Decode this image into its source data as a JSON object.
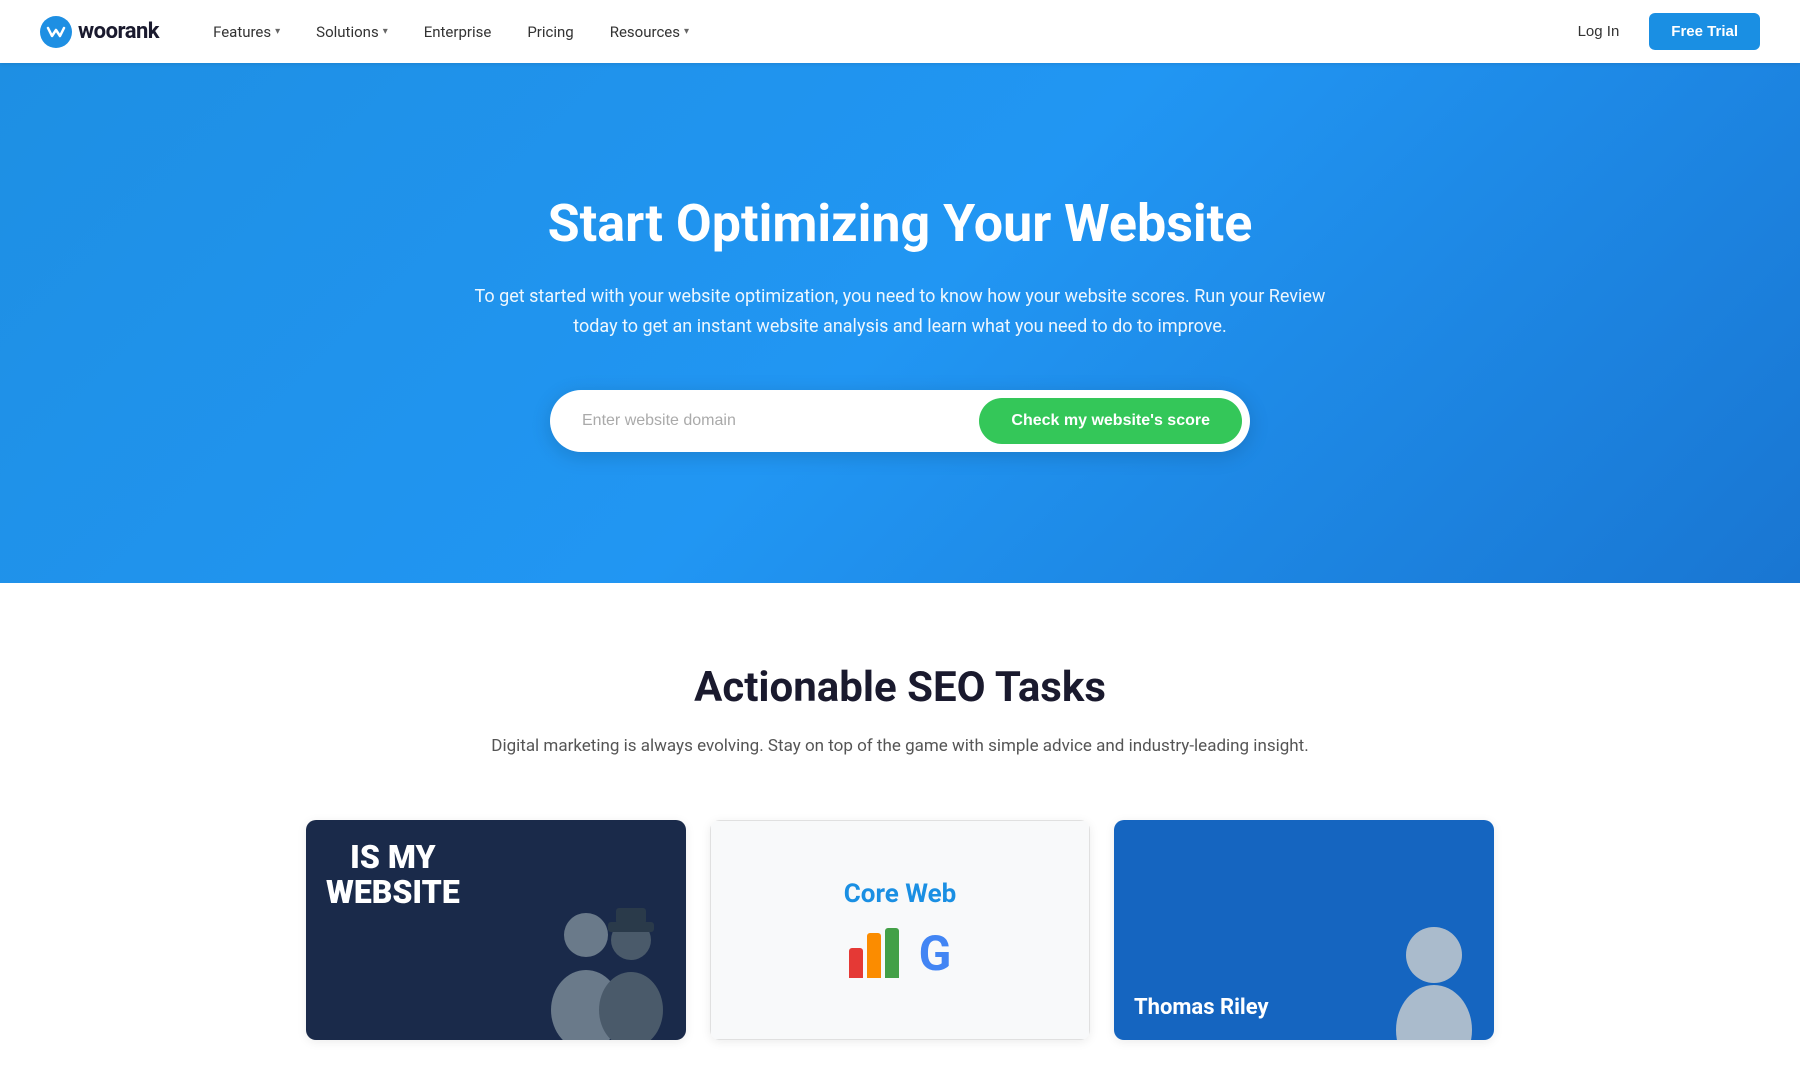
{
  "navbar": {
    "logo_text": "woorank",
    "nav_items": [
      {
        "label": "Features",
        "has_dropdown": true
      },
      {
        "label": "Solutions",
        "has_dropdown": true
      },
      {
        "label": "Enterprise",
        "has_dropdown": false
      },
      {
        "label": "Pricing",
        "has_dropdown": false
      },
      {
        "label": "Resources",
        "has_dropdown": true
      }
    ],
    "login_label": "Log In",
    "free_trial_label": "Free Trial"
  },
  "hero": {
    "title": "Start Optimizing Your Website",
    "subtitle": "To get started with your website optimization, you need to know how your website scores. Run your Review today to get an instant website analysis and learn what you need to do to improve.",
    "search_placeholder": "Enter website domain",
    "search_button_label": "Check my website's score"
  },
  "seo_section": {
    "title": "Actionable SEO Tasks",
    "subtitle": "Digital marketing is always evolving. Stay on top of the game with simple advice and industry-leading insight."
  },
  "cards": [
    {
      "id": "card-left",
      "type": "dark",
      "title_line1": "IS MY",
      "title_line2": "WEBSITE",
      "bg": "dark-blue"
    },
    {
      "id": "card-middle",
      "type": "light",
      "title": "Core Web",
      "bg": "white"
    },
    {
      "id": "card-right",
      "type": "blue",
      "person_name": "Thomas Riley",
      "bg": "blue"
    }
  ],
  "colors": {
    "primary_blue": "#1e8fe3",
    "dark_navy": "#1a2a4a",
    "green": "#34c759",
    "core_web_blue": "#1a8fe3"
  }
}
